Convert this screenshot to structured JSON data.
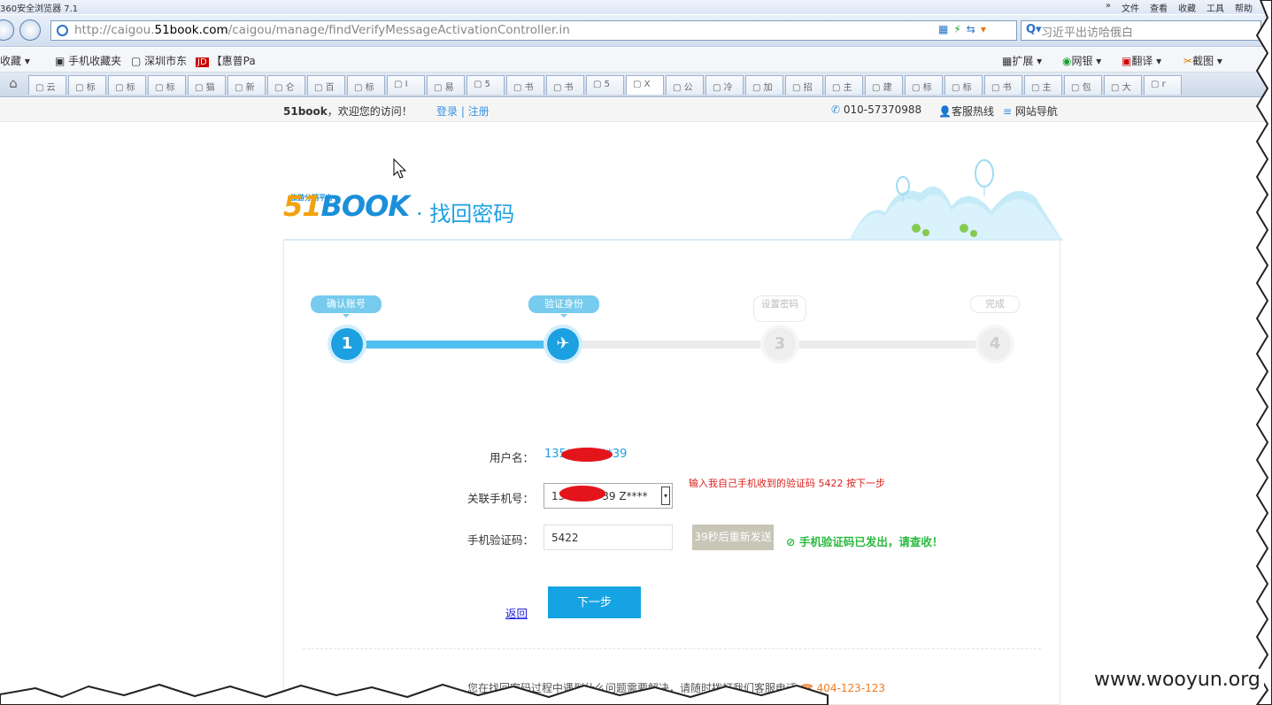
{
  "browser": {
    "title": "360安全浏览器 7.1",
    "menus": [
      "»",
      "文件",
      "查看",
      "收藏",
      "工具",
      "帮助"
    ],
    "url_prefix": "http://caigou.",
    "url_domain": "51book.com",
    "url_path": "/caigou/manage/findVerifyMessageActivationController.in",
    "search_placeholder": "习近平出访哈俄白",
    "search_icon": "Q▾",
    "favorites": {
      "fav_label": "收藏 ▾",
      "items": [
        "手机收藏夹",
        "深圳市东",
        "【惠普Pa"
      ],
      "jd_badge": "JD",
      "tools": [
        "扩展 ▾",
        "网银 ▾",
        "翻译 ▾",
        "截图 ▾"
      ]
    },
    "tabs": [
      "云",
      "标",
      "标",
      "标",
      "猫",
      "新",
      "仑",
      "百",
      "标",
      "I",
      "易",
      "5",
      "书",
      "书",
      "5",
      "X",
      "公",
      "冷",
      "加",
      "招",
      "主",
      "建",
      "标",
      "标",
      "书",
      "主",
      "包",
      "大",
      "r"
    ]
  },
  "site_top": {
    "brand": "51book",
    "welcome": "，欢迎您的访问！",
    "login": "登录",
    "sep": "|",
    "register": "注册",
    "phone": "010-57370988",
    "hotline": "客服热线",
    "sitenav": "网站导航"
  },
  "header": {
    "logo_51": "51",
    "logo_book": "BOOK",
    "logo_tag": "旅游分销平台",
    "title": "· 找回密码"
  },
  "steps": [
    {
      "label": "确认账号",
      "num": "1",
      "state": "done"
    },
    {
      "label": "验证身份",
      "num": "✈",
      "state": "current"
    },
    {
      "label": "设置密码",
      "num": "3",
      "state": "todo"
    },
    {
      "label": "完成",
      "num": "4",
      "state": "todo"
    }
  ],
  "form": {
    "username_label": "用户名：",
    "username_value": "135********39",
    "phone_label": "关联手机号：",
    "phone_value": "13*******39 Z****",
    "code_label": "手机验证码：",
    "code_value": "5422",
    "resend": "39秒后重新发送",
    "sms_status": "手机验证码已发出，请查收！",
    "back": "返回",
    "next": "下一步"
  },
  "annotation": "输入我自己手机收到的验证码 5422   按下一步",
  "footer": {
    "help_text": "您在找回密码过程中遇到什么问题需要解决，请随时拨打我们客服电话",
    "help_phone": "404-123-123"
  },
  "watermark": "www.wooyun.org",
  "colors": {
    "accent": "#1ca0e2",
    "logo_orange": "#f2a20d",
    "success": "#2aba3e",
    "annotation": "#d9211f",
    "phone": "#f07a22"
  }
}
